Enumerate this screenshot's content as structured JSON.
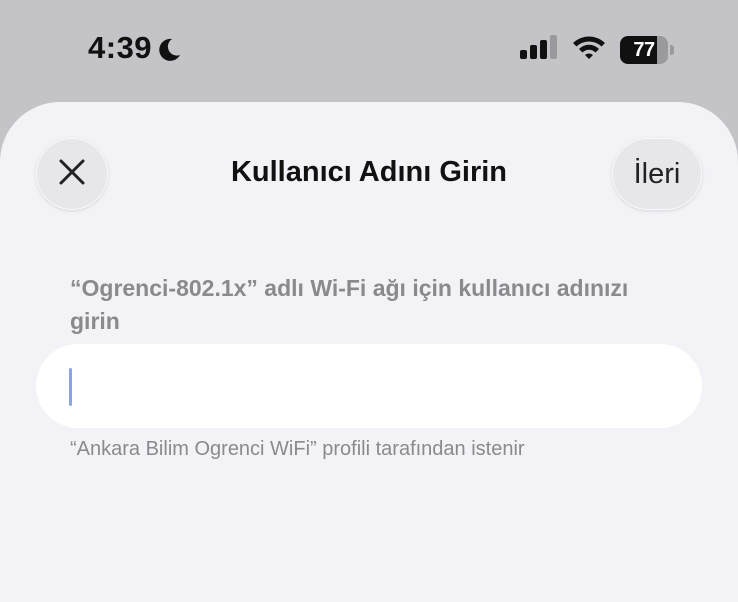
{
  "status_bar": {
    "time": "4:39",
    "battery_level": "77",
    "battery_fraction": 0.77,
    "icons": [
      "moon-icon",
      "signal-icon",
      "wifi-icon",
      "battery-icon"
    ]
  },
  "sheet": {
    "title": "Kullanıcı Adını Girin",
    "close_icon": "close-icon",
    "next_label": "İleri",
    "prompt": "“Ogrenci-802.1x” adlı Wi-Fi ağı için kullanıcı adınızı girin",
    "username_value": "",
    "footnote": "“Ankara Bilim Ogrenci WiFi” profili tarafından istenir"
  },
  "colors": {
    "status_bar_background": "#c3c3c8",
    "sheet_background": "#f2f2f7",
    "secondary_text": "#8a8a8e",
    "cursor": "#8aa6e0"
  }
}
